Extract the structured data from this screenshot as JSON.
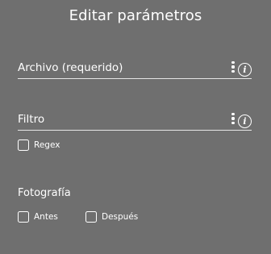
{
  "dialog": {
    "title": "Editar parámetros"
  },
  "fields": {
    "archivo": {
      "label": "Archivo (requerido)",
      "menu_icon": "kebab-icon",
      "info_icon": "info-icon",
      "info_glyph": "i"
    },
    "filtro": {
      "label": "Filtro",
      "menu_icon": "kebab-icon",
      "info_icon": "info-icon",
      "info_glyph": "i"
    }
  },
  "options": {
    "regex": {
      "label": "Regex",
      "checked": false
    }
  },
  "fotografia": {
    "heading": "Fotografía",
    "antes": {
      "label": "Antes",
      "checked": false
    },
    "despues": {
      "label": "Después",
      "checked": false
    }
  }
}
